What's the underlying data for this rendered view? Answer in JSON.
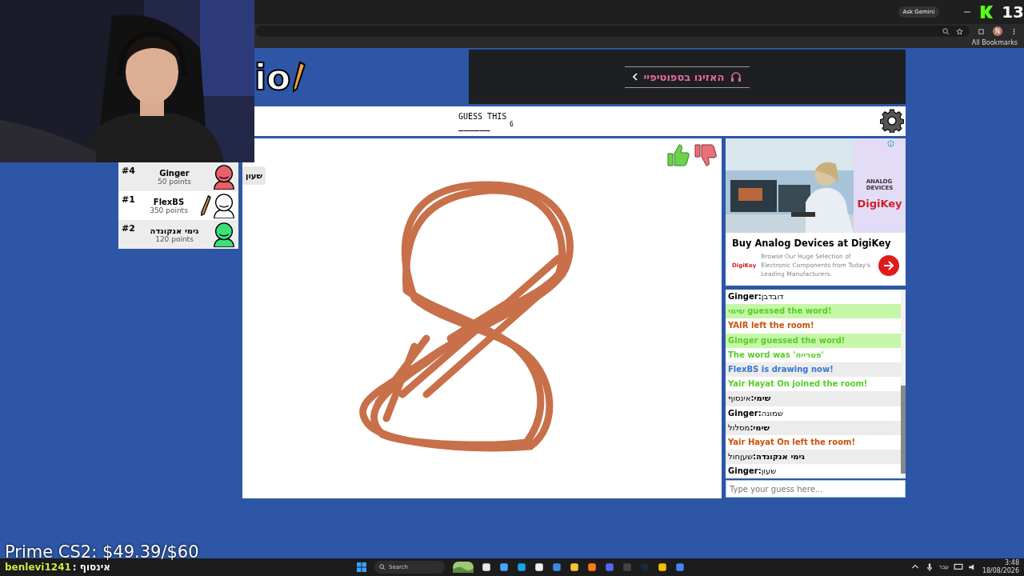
{
  "browser": {
    "gemini_button": "Ask Gemini",
    "profile": "N",
    "bookmarks": "All Bookmarks"
  },
  "stream_overlay": {
    "counter": "13",
    "goal": "Prime CS2: $49.39/$60",
    "chat_user": "benlevi1241",
    "chat_message": ": אינסוף"
  },
  "top_ad": {
    "text": "האזינו בספוטיפיי"
  },
  "logo": {
    "text": "io"
  },
  "header": {
    "label": "GUESS THIS",
    "word_length": "6",
    "hint": "______"
  },
  "players": [
    {
      "rank": "#4",
      "name": "Ginger",
      "points": "50 points",
      "color": "#e8606a",
      "drawing": false,
      "bubble": "שעון"
    },
    {
      "rank": "#1",
      "name": "FlexBS",
      "points": "350 points",
      "color": "#ffffff",
      "drawing": true
    },
    {
      "rank": "#2",
      "name": "גימי אנקונדה",
      "points": "120 points",
      "color": "#3ee07a",
      "drawing": false
    }
  ],
  "side_ad": {
    "partner_top": "ANALOG",
    "partner_bottom": "DEVICES",
    "brand": "DigiKey",
    "title": "Buy Analog Devices at DigiKey",
    "small_brand": "DigiKey",
    "description": "Browse Our Huge Selection of Electronic Components from Today's Leading Manufacturers."
  },
  "chat": {
    "messages": [
      {
        "kind": "guess",
        "name": "Ginger:",
        "text": "דובדבן"
      },
      {
        "kind": "correct",
        "text": "שימי guessed the word!"
      },
      {
        "kind": "leave",
        "text": "YAIR left the room!"
      },
      {
        "kind": "correct",
        "text": "Ginger guessed the word!"
      },
      {
        "kind": "info",
        "text": "The word was 'פטרייה'"
      },
      {
        "kind": "drawing",
        "text": "FlexBS is drawing now!"
      },
      {
        "kind": "info",
        "text": "Yair Hayat On joined the room!"
      },
      {
        "kind": "guess",
        "name": "שימי:",
        "text": "אינסוף"
      },
      {
        "kind": "guess",
        "name": "Ginger:",
        "text": "שמונה"
      },
      {
        "kind": "guess",
        "name": "שימי:",
        "text": "מסלול"
      },
      {
        "kind": "leave",
        "text": "Yair Hayat On left the room!"
      },
      {
        "kind": "guess",
        "name": "גימי אנקונדה:",
        "text": "שעןחול"
      },
      {
        "kind": "guess",
        "name": "Ginger:",
        "text": "שעון"
      }
    ],
    "placeholder": "Type your guess here..."
  },
  "taskbar": {
    "search_placeholder": "Search",
    "language": "עבר",
    "time": "3:48",
    "date": "18/08/2026"
  }
}
